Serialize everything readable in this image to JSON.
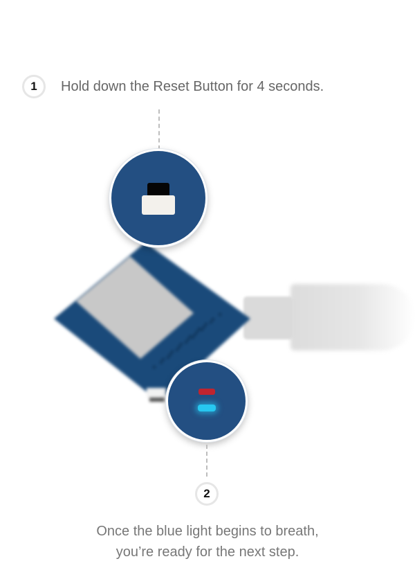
{
  "step1": {
    "number": "1",
    "text": "Hold down the Reset Button for 4 seconds."
  },
  "step2": {
    "number": "2",
    "text_line1": "Once the blue light begins to breath,",
    "text_line2": "you’re ready for the next step."
  },
  "colors": {
    "board": "#1a4a7a",
    "zoom_circle": "#234f82",
    "chip": "#c8c8c8",
    "reset_button_cap": "#050505",
    "reset_button_base": "#f3f1ec",
    "led_red": "#c0242f",
    "led_blue": "#27c7f0",
    "dashed_line": "#bdbdbd"
  },
  "icons": {
    "device": "board-illustration",
    "reset_button": "reset-button-icon",
    "status_leds": "status-led-icon"
  }
}
